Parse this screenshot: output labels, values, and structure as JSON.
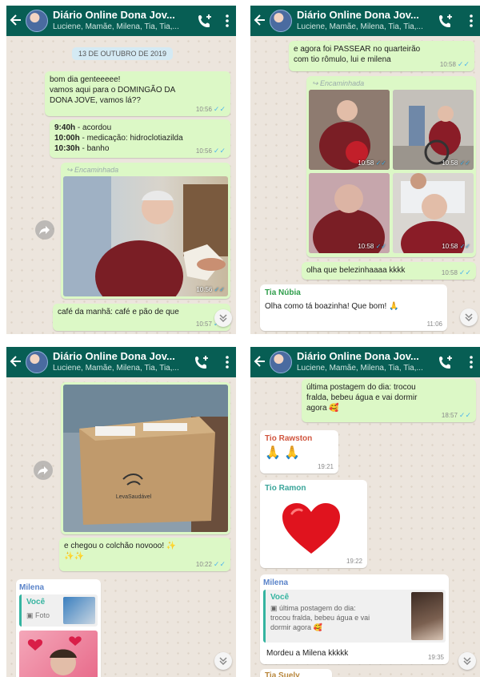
{
  "chat": {
    "title": "Diário Online Dona Jov...",
    "subtitle": "Luciene, Mamãe, Milena, Tia, Tia,..."
  },
  "colors": {
    "header": "#075e54",
    "outgoing": "#dcf8c6",
    "incoming": "#ffffff",
    "ticks": "#4fb6ec"
  },
  "panel1": {
    "date_chip": "13 DE OUTUBRO DE 2019",
    "msg1": {
      "lines": [
        "bom dia genteeeee!",
        "vamos aqui para o DOMINGÃO DA",
        "DONA JOVE, vamos lá??"
      ],
      "time": "10:56"
    },
    "msg2": {
      "rows": [
        {
          "t": "9:40h",
          "d": " - acordou"
        },
        {
          "t": "10:00h",
          "d": " - medicação: hidroclotiazilda"
        },
        {
          "t": "10:30h",
          "d": " - banho"
        }
      ],
      "time": "10:56"
    },
    "forwarded": "Encaminhada",
    "photo_time": "10:56",
    "msg3": {
      "text": "café da manhã: café e pão de que",
      "time": "10:57"
    }
  },
  "panel2": {
    "msg1": {
      "lines": [
        "e agora foi PASSEAR no quarteirão",
        "com tio rômulo, lui e milena"
      ],
      "time": "10:58"
    },
    "forwarded": "Encaminhada",
    "photo_times": [
      "10:58",
      "10:58",
      "10:58",
      "10:58"
    ],
    "msg2": {
      "text": "olha que belezinhaaaa kkkk",
      "time": "10:58"
    },
    "msg3": {
      "sender": "Tia Núbia",
      "text": "Olha como tá boazinha! Que bom! 🙏",
      "time": "11:06"
    }
  },
  "panel3": {
    "box_label": "LevaSaudável",
    "msg1": {
      "lines": [
        "e chegou o colchão novooo! ✨",
        "✨✨"
      ],
      "time": "10:22"
    },
    "reply": {
      "sender": "Milena",
      "quote_author": "Você",
      "quote_text": "Foto"
    }
  },
  "panel4": {
    "msg1": {
      "lines": [
        "última postagem do dia: trocou",
        "fralda, bebeu água e vai dormir",
        "agora 🥰"
      ],
      "time": "18:57"
    },
    "msg2": {
      "sender": "Tio Rawston",
      "text": "🙏 🙏",
      "time": "19:21"
    },
    "msg3": {
      "sender": "Tio Ramon",
      "time": "19:22"
    },
    "msg4": {
      "sender": "Milena",
      "quote_author": "Você",
      "quote_lines": [
        "última postagem do dia:",
        "trocou fralda, bebeu água e vai",
        "dormir agora 🥰"
      ],
      "text": "Mordeu a Milena kkkkk",
      "time": "19:35"
    },
    "next_sender": "Tia Suely"
  }
}
